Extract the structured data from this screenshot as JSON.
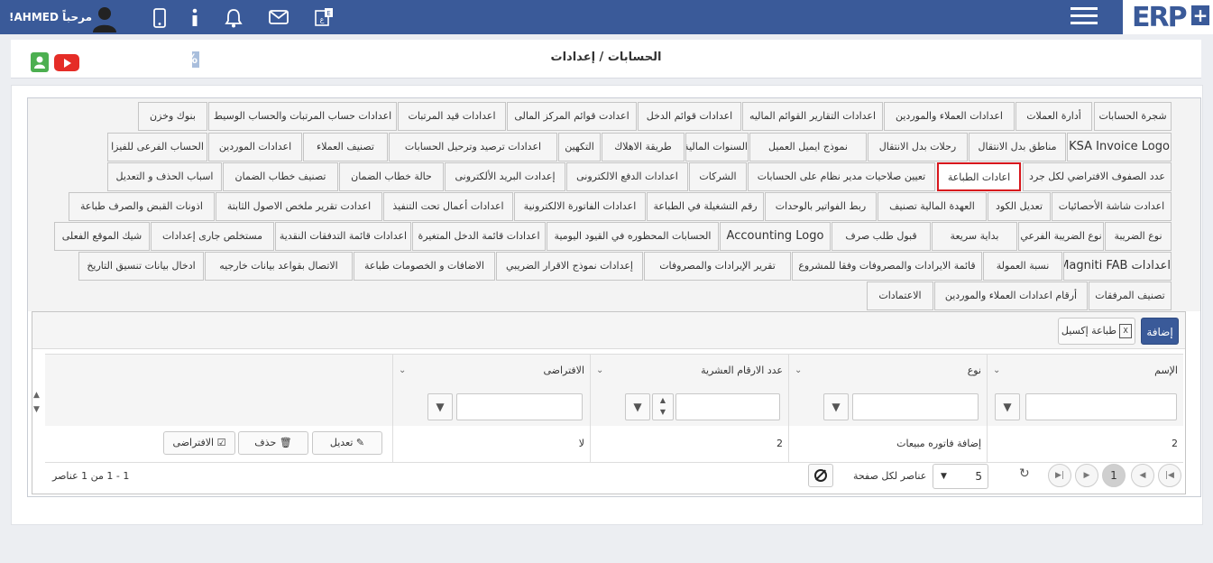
{
  "topbar": {
    "welcome": "مرحباً AHMED!",
    "logo_text": "ERP",
    "logo_plus": "+",
    "icons": [
      "user-avatar-icon",
      "phone-icon",
      "info-icon",
      "bell-icon",
      "mail-icon",
      "language-icon",
      "menu-icon"
    ]
  },
  "header": {
    "title": "الحسابات / إعدادات",
    "progress_text": "25%",
    "progress_value": 0.25,
    "icons": [
      "contact-icon",
      "youtube-icon"
    ]
  },
  "tabs": [
    [
      "شجرة الحسابات",
      "أدارة العملات",
      "اعدادات العملاء والموردين",
      "اعدادات التقارير القوائم الماليه",
      "اعدادات قوائم الدخل",
      "اعدادت قوائم المركز المالى",
      "اعدادات قيد المرتبات",
      "اعدادات حساب المرتبات والحساب الوسيط",
      "بنوك وخزن"
    ],
    [
      "KSA Invoice Logo",
      "مناطق بدل الانتقال",
      "رحلات بدل الانتقال",
      "نموذج ايميل العميل",
      "السنوات المالية",
      "طريقة الاهلاك",
      "التكهين",
      "اعدادات ترصيد وترحيل الحسابات",
      "تصنيف العملاء",
      "اعدادات الموردين",
      "الحساب الفرعى للفيزا"
    ],
    [
      "عدد الصفوف الافتراضي لكل جرد",
      "اعادات الطباعة",
      "تعيين صلاحيات مدير نظام على الحسابات",
      "الشركات",
      "اعدادات الدفع الالكترونى",
      "إعدادت البريد الألكترونى",
      "حالة خطاب الضمان",
      "تصنيف خطاب الضمان",
      "اسباب الحذف و التعديل"
    ],
    [
      "اعدادت شاشة الأحصائيات",
      "تعديل الكود",
      "العهدة المالية تصنيف",
      "ربط الفواتير بالوحدات",
      "رقم التشغيلة في الطباعة",
      "اعدادات الفاتورة الالكترونية",
      "اعدادات أعمال تحت التنفيذ",
      "اعدادت تقرير ملخص الاصول الثابتة",
      "اذونات القبض والصرف طباعة"
    ],
    [
      "نوع الضريبة",
      "نوع الضريبة الفرعي",
      "بداية سريعة",
      "قبول طلب صرف",
      "Accounting Logo",
      "الحسابات المحظوره في القيود اليومية",
      "اعدادات قائمة الدخل المتغيرة",
      "اعدادات قائمة التدفقات النقدية",
      "مستخلص جارى إعدادات",
      "شيك الموقع الفعلى"
    ],
    [
      "اعدادات Magniti FAB",
      "نسبة العمولة",
      "قائمة الايرادات والمصروفات وفقا للمشروع",
      "تقرير الإيرادات والمصروفات",
      "إعدادات نموذج الاقرار الضريبي",
      "الاضافات و الخصومات طباعة",
      "الاتصال بقواعد بيانات خارجيه",
      "ادخال بيانات تنسيق التاريخ"
    ],
    [
      "تصنيف المرفقات",
      "أرقام اعدادات العملاء والموردين",
      "الاعتمادات"
    ]
  ],
  "toolbar": {
    "add": "إضافة",
    "excel": "طباعة إكسيل"
  },
  "grid": {
    "columns": [
      "الإسم",
      "نوع",
      "عدد الارقام العشرية",
      "الافتراضى"
    ],
    "row": {
      "name": "2",
      "type": "إضافة فاتوره مبيعات",
      "decimals": "2",
      "default": "لا"
    },
    "row_actions": {
      "edit": "تعديل",
      "delete": "حذف",
      "default": "الافتراضى"
    }
  },
  "pager": {
    "current_page": "1",
    "page_size": "5",
    "per_page_label": "عناصر لكل صفحة",
    "summary": "1 - 1 من 1 عناصر"
  },
  "colors": {
    "topbar": "#3a5a99",
    "selected_tab_border": "#d8161c",
    "add_button": "#3a5a99"
  }
}
